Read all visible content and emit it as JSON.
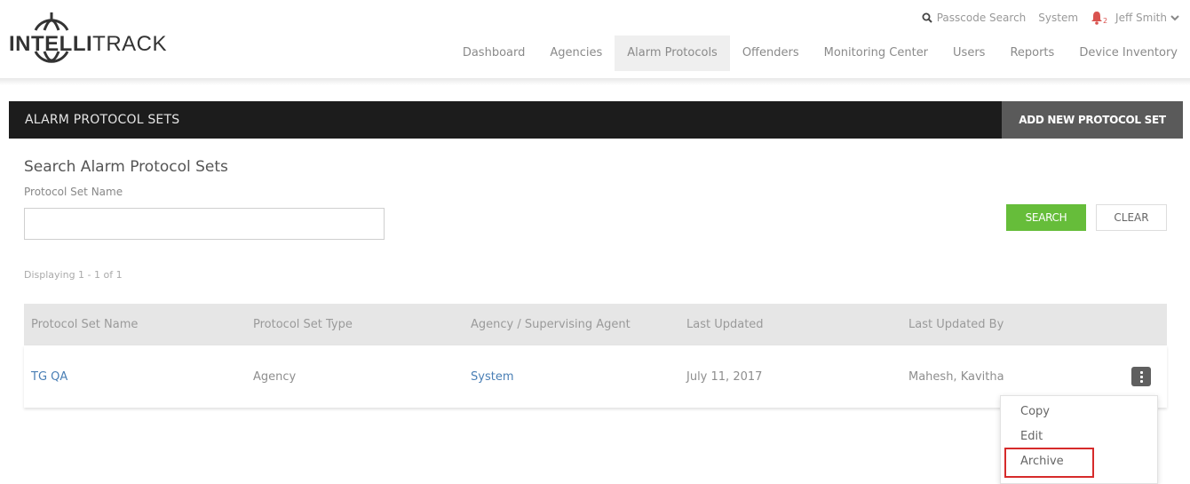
{
  "brand": {
    "name_bold": "INTELLI",
    "name_light": "TRACK"
  },
  "util": {
    "passcode_search": "Passcode Search",
    "system": "System",
    "notifications_count": "2",
    "user_name": "Jeff Smith"
  },
  "nav": {
    "items": [
      {
        "label": "Dashboard"
      },
      {
        "label": "Agencies"
      },
      {
        "label": "Alarm Protocols"
      },
      {
        "label": "Offenders"
      },
      {
        "label": "Monitoring Center"
      },
      {
        "label": "Users"
      },
      {
        "label": "Reports"
      },
      {
        "label": "Device Inventory"
      }
    ],
    "active": "Alarm Protocols"
  },
  "section": {
    "title": "ALARM PROTOCOL SETS",
    "add_button": "ADD NEW PROTOCOL SET"
  },
  "search": {
    "title": "Search Alarm Protocol Sets",
    "field_label": "Protocol Set Name",
    "field_value": "",
    "search_button": "SEARCH",
    "clear_button": "CLEAR"
  },
  "results": {
    "displaying": "Displaying 1 - 1 of 1",
    "columns": [
      "Protocol Set Name",
      "Protocol Set Type",
      "Agency / Supervising Agent",
      "Last Updated",
      "Last Updated By"
    ],
    "rows": [
      {
        "name": "TG QA",
        "type": "Agency",
        "agency": "System",
        "last_updated": "July 11, 2017",
        "updated_by": "Mahesh, Kavitha"
      }
    ]
  },
  "row_menu": {
    "items": [
      "Copy",
      "Edit",
      "Archive"
    ],
    "highlighted": "Archive"
  },
  "colors": {
    "header_bar": "#1c1c1c",
    "add_button_bg": "#5a5a5a",
    "search_button": "#66bd3a",
    "link": "#4a7fb5",
    "highlight_box": "#d62b2b",
    "bell": "#d9534f"
  }
}
